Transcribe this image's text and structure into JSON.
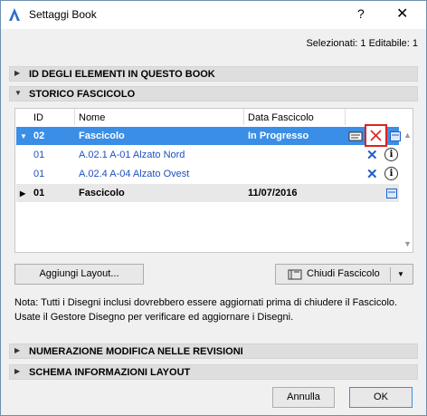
{
  "window": {
    "title": "Settaggi Book",
    "help": "?",
    "close": "✕"
  },
  "selection_info": "Selezionati: 1 Editabile: 1",
  "sections": {
    "book_ids": "ID DEGLI ELEMENTI IN QUESTO BOOK",
    "history": "STORICO FASCICOLO",
    "revision_numbering": "NUMERAZIONE MODIFICA NELLE REVISIONI",
    "layout_info": "SCHEMA INFORMAZIONI LAYOUT"
  },
  "table": {
    "headers": {
      "id": "ID",
      "name": "Nome",
      "date": "Data Fascicolo"
    },
    "rows": [
      {
        "id": "02",
        "name": "Fascicolo",
        "date": "In Progresso"
      },
      {
        "id": "01",
        "name": "A.02.1 A-01 Alzato Nord"
      },
      {
        "id": "01",
        "name": "A.02.4 A-04 Alzato Ovest"
      },
      {
        "id": "01",
        "name": "Fascicolo",
        "date": "11/07/2016"
      }
    ]
  },
  "buttons": {
    "add_layout": "Aggiungi Layout...",
    "close_issue": "Chiudi Fascicolo",
    "cancel": "Annulla",
    "ok": "OK"
  },
  "note": "Nota: Tutti i Disegni inclusi dovrebbero essere aggiornati prima di chiudere il Fascicolo. Usate il Gestore Disegno per verificare ed aggiornare i Disegni.",
  "colors": {
    "selection": "#3a8ee6",
    "link_blue": "#2050c0",
    "highlight_red": "#e02020"
  }
}
